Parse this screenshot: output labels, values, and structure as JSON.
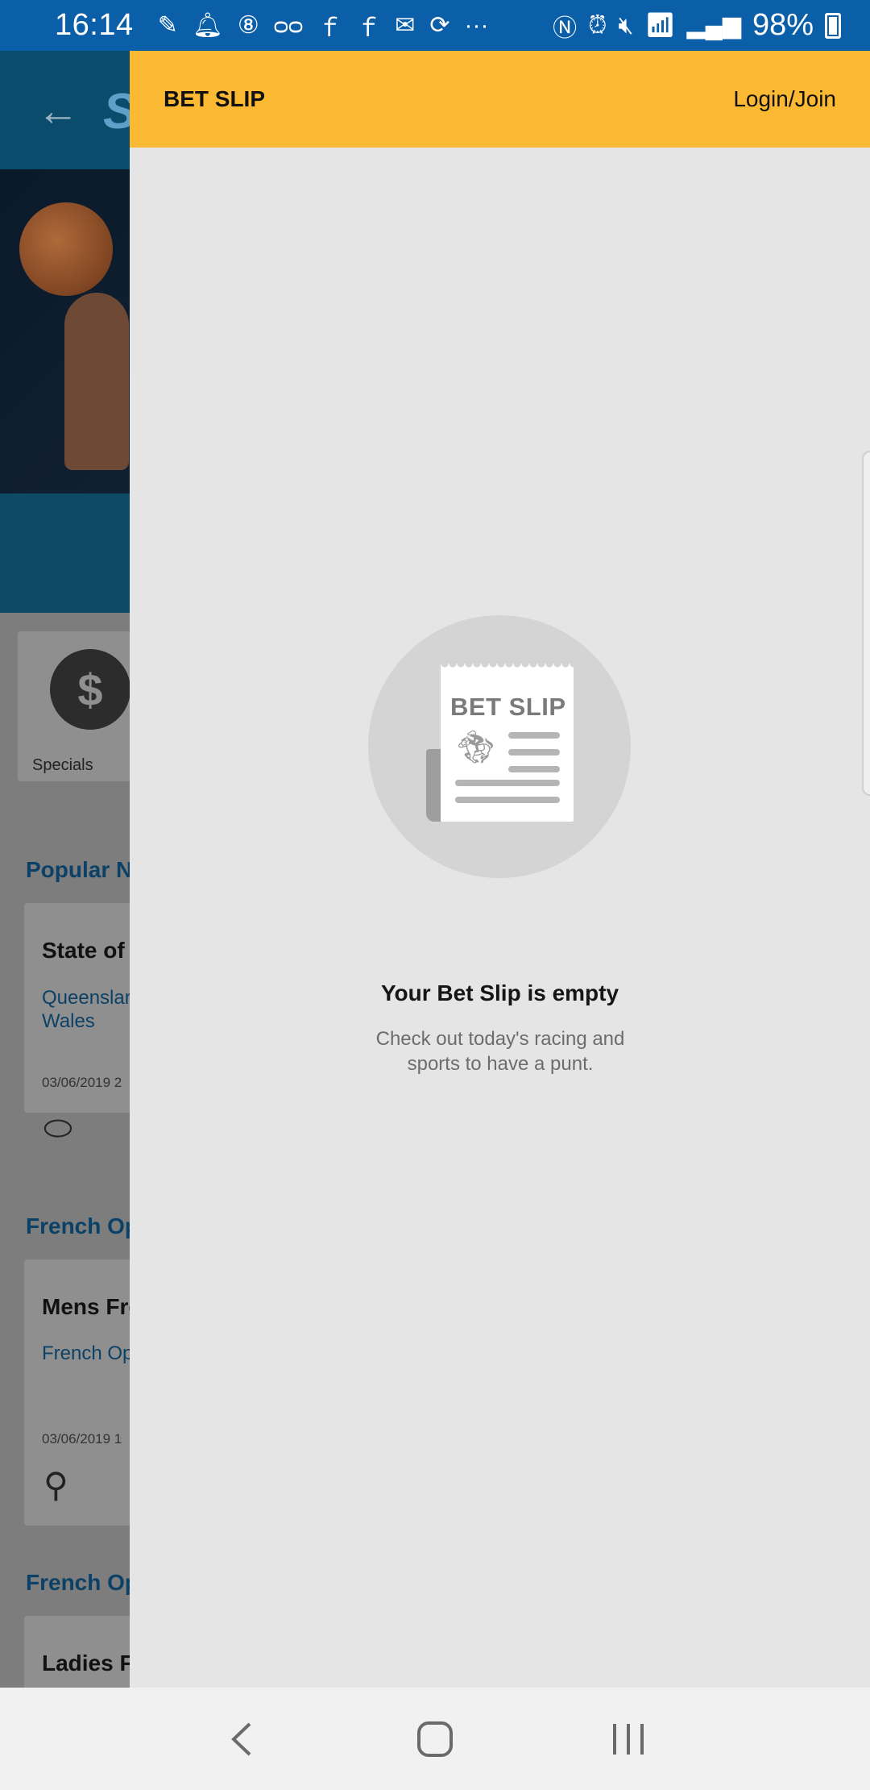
{
  "status_bar": {
    "time": "16:14",
    "battery": "98%",
    "icons_left": [
      "pen-icon",
      "bell-icon",
      "8-ball-icon",
      "voicemail-icon",
      "facebook-icon",
      "facebook-icon",
      "outlook-icon",
      "sync-icon",
      "more-icon"
    ],
    "icons_right": [
      "nfc-icon",
      "alarm-icon",
      "mute-icon",
      "wifi-icon",
      "signal-icon",
      "battery-icon"
    ]
  },
  "background_app": {
    "tile_label": "Specials",
    "sections": [
      {
        "title": "Popular N",
        "card_title": "State of",
        "card_sub": "Queenslar\nWales",
        "card_date": "03/06/2019 2"
      },
      {
        "title": "French Op",
        "card_title": "Mens Fre",
        "card_sub": "French Op",
        "card_date": "03/06/2019 1"
      },
      {
        "title": "French Op",
        "card_title": "Ladies F"
      }
    ]
  },
  "drawer": {
    "title": "BET SLIP",
    "login_label": "Login/Join",
    "illustration_text": "BET SLIP",
    "empty_heading": "Your Bet Slip is empty",
    "empty_sub": "Check out today's racing and sports to have a punt."
  },
  "colors": {
    "status_bar": "#0a5fa8",
    "drawer_header": "#fbb934",
    "drawer_bg": "#e5e5e5"
  }
}
